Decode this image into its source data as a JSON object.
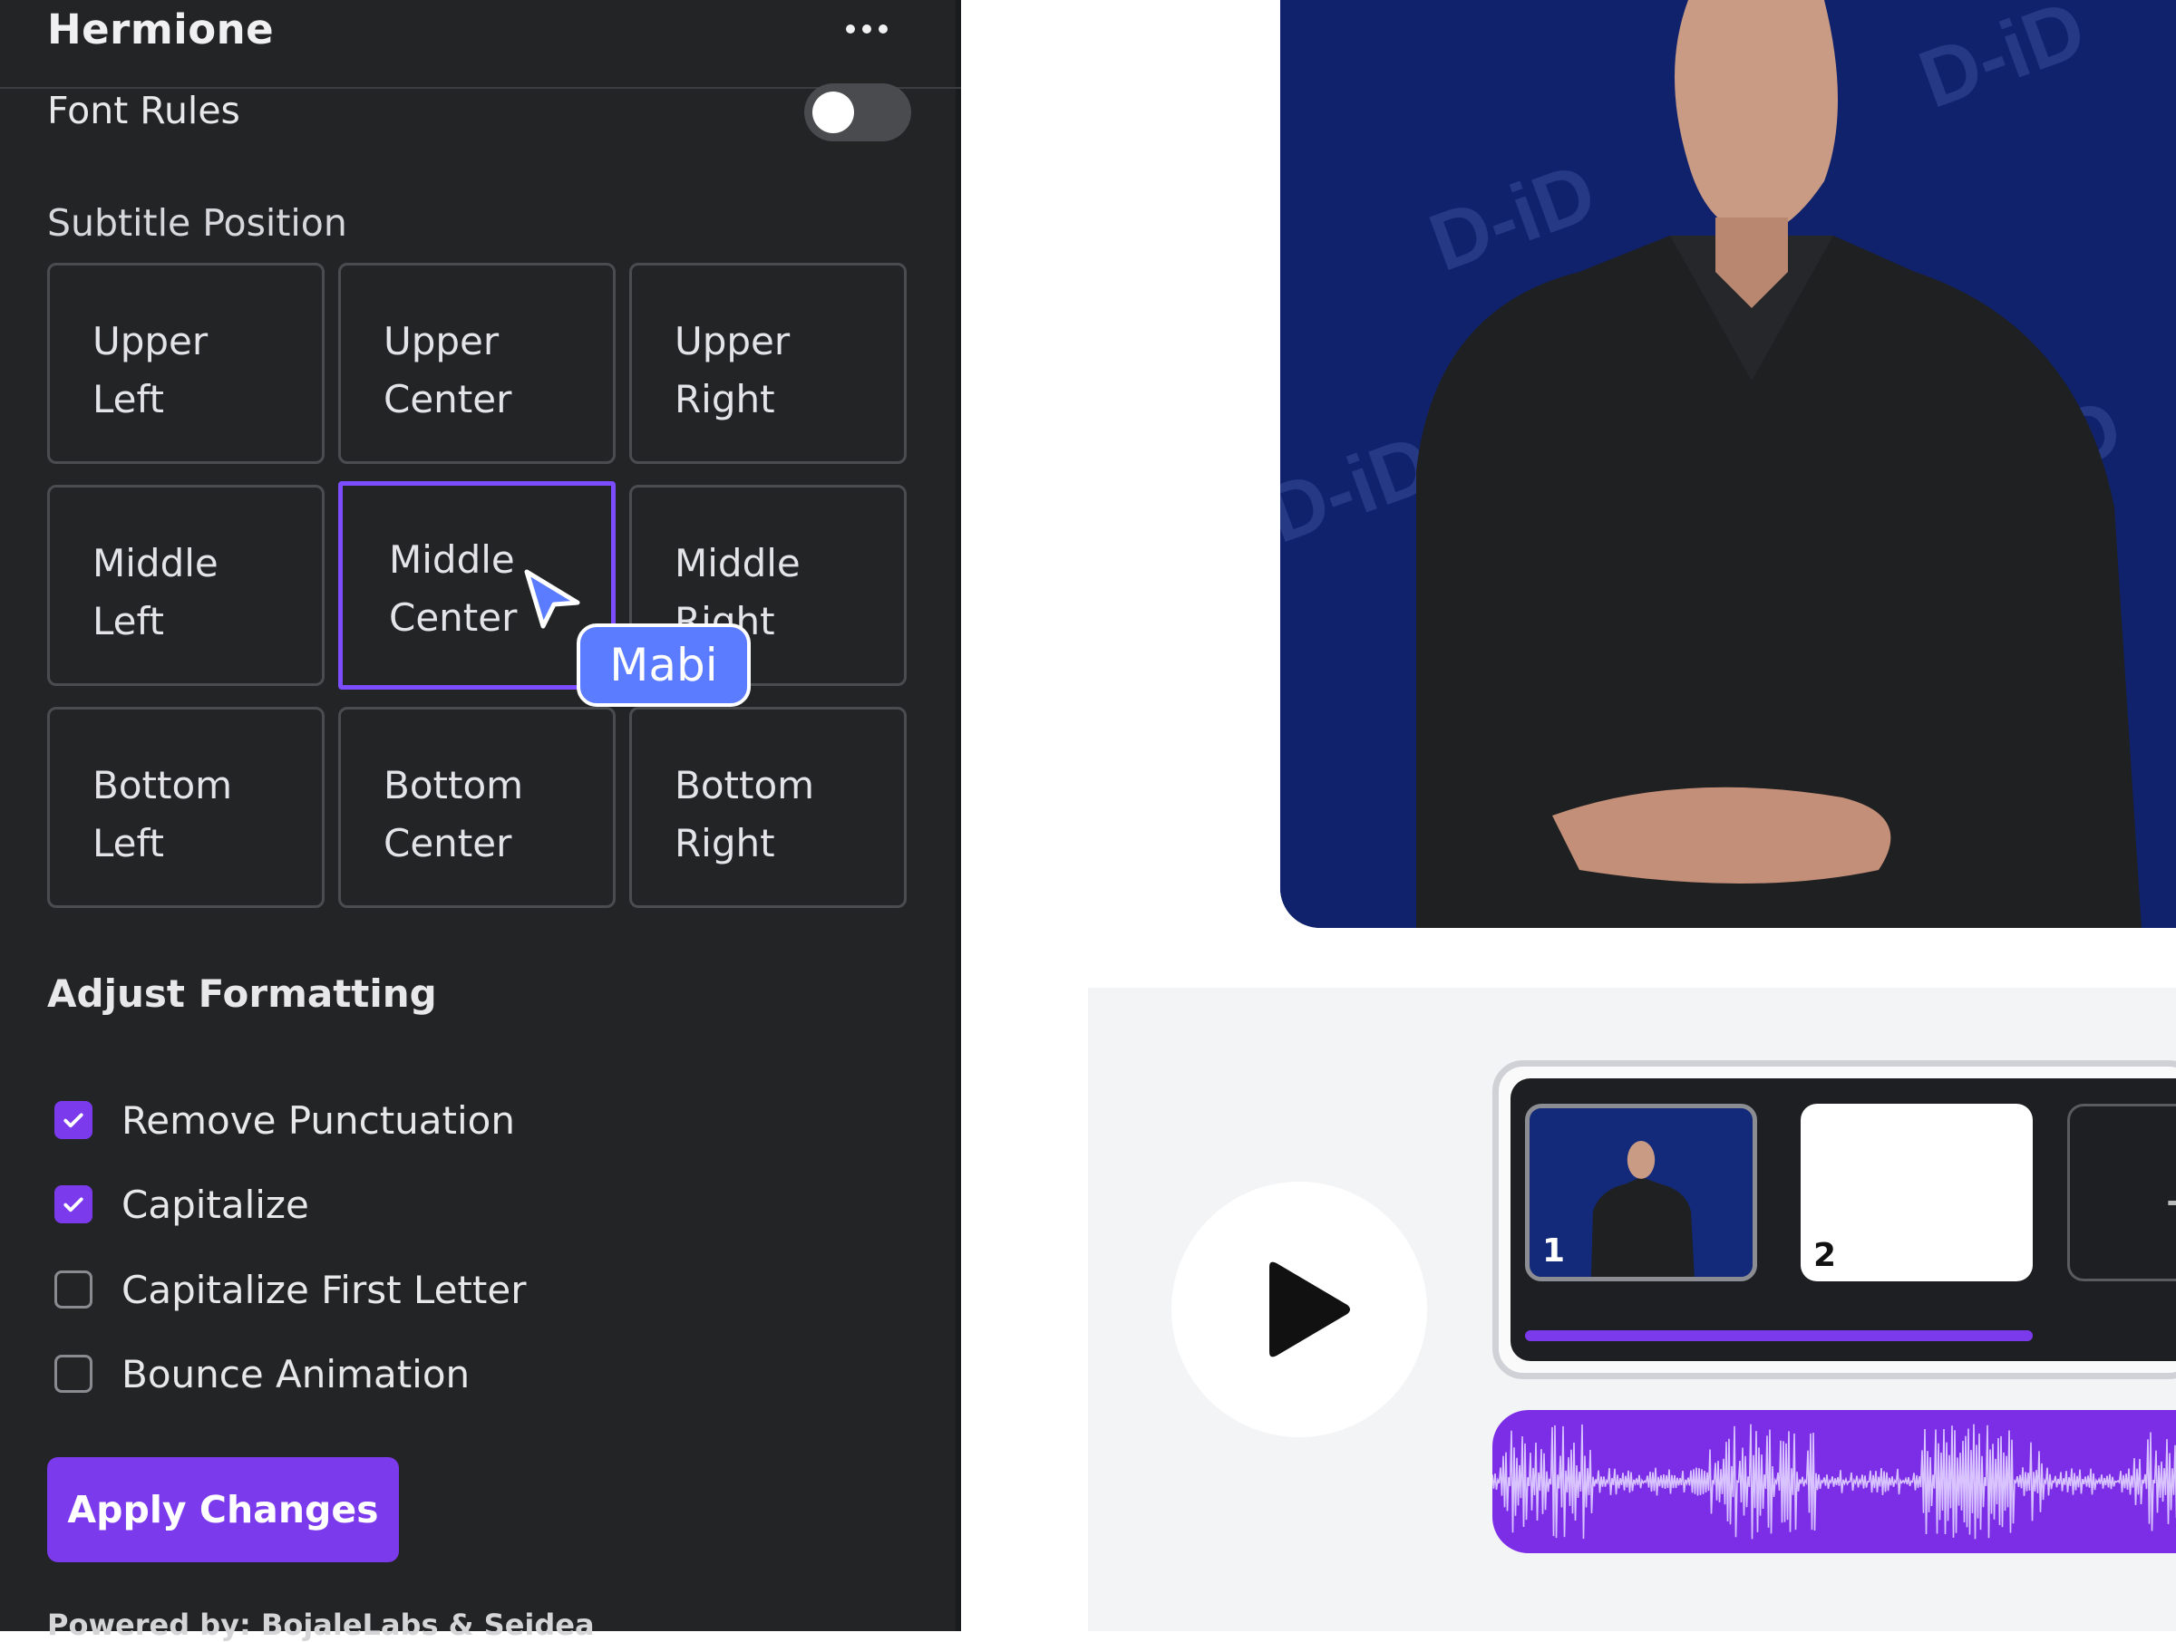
{
  "app": {
    "title": "Hermione"
  },
  "header": {
    "more_icon": "more-horizontal-icon"
  },
  "font_rules": {
    "label": "Font Rules",
    "enabled": false
  },
  "subtitle_position": {
    "label": "Subtitle Position",
    "selected": "Middle Center",
    "cells": [
      {
        "id": "upper-left",
        "text": "Upper\nLeft"
      },
      {
        "id": "upper-center",
        "text": "Upper\nCenter"
      },
      {
        "id": "upper-right",
        "text": "Upper\nRight"
      },
      {
        "id": "middle-left",
        "text": "Middle\nLeft"
      },
      {
        "id": "middle-center",
        "text": "Middle\nCenter"
      },
      {
        "id": "middle-right",
        "text": "Middle\nRight"
      },
      {
        "id": "bottom-left",
        "text": "Bottom\nLeft"
      },
      {
        "id": "bottom-center",
        "text": "Bottom\nCenter"
      },
      {
        "id": "bottom-right",
        "text": "Bottom\nRight"
      }
    ]
  },
  "formatting": {
    "title": "Adjust Formatting",
    "options": [
      {
        "label": "Remove Punctuation",
        "checked": true
      },
      {
        "label": "Capitalize",
        "checked": true
      },
      {
        "label": "Capitalize First Letter",
        "checked": false
      },
      {
        "label": "Bounce Animation",
        "checked": false
      }
    ]
  },
  "apply_button": {
    "label": "Apply Changes"
  },
  "footer": {
    "powered_by": "Powered by: BojaleLabs & Seidea"
  },
  "cursor": {
    "user_name": "Mabi",
    "color": "#5b7cff"
  },
  "video": {
    "watermark": "D-iD"
  },
  "timeline": {
    "scenes": [
      {
        "number": "1"
      },
      {
        "number": "2"
      }
    ],
    "add_scene_symbol": "+",
    "progress": 0.75
  },
  "colors": {
    "accent": "#7c3aed",
    "panel_bg": "#232426",
    "video_bg": "#10226b",
    "cursor_tag": "#5b7cff"
  }
}
